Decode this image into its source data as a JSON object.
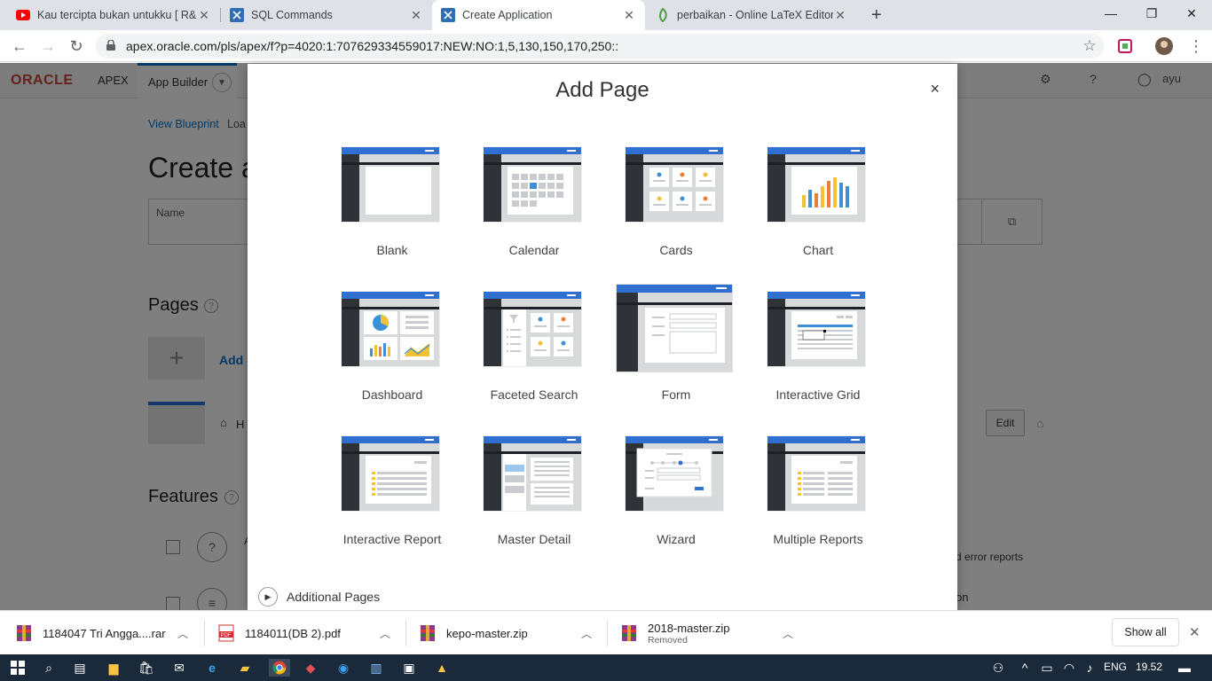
{
  "browser": {
    "tabs": [
      {
        "title": "Kau tercipta bukan untukku [ R&",
        "icon": "youtube-icon"
      },
      {
        "title": "SQL Commands",
        "icon": "apex-icon"
      },
      {
        "title": "Create Application",
        "icon": "apex-icon"
      },
      {
        "title": "perbaikan - Online LaTeX Editor O",
        "icon": "overleaf-icon"
      }
    ],
    "new_tab": "+",
    "url": "apex.oracle.com/pls/apex/f?p=4020:1:707629334559017:NEW:NO:1,5,130,150,170,250::"
  },
  "apex": {
    "logo": "ORACLE",
    "apex_label": "APEX",
    "app_builder": "App Builder",
    "user": "ayu",
    "breadcrumbs": [
      "View Blueprint",
      "Loa"
    ],
    "page_title": "Create a",
    "name_label": "Name",
    "pages_heading": "Pages",
    "add_link": "Add",
    "home_text": "H",
    "edit_button": "Edit",
    "features_heading": "Features",
    "feature_text_1": "d error reports",
    "feature_text_2": "on",
    "feature_letter": "A"
  },
  "modal": {
    "title": "Add Page",
    "close": "×",
    "page_types": [
      {
        "label": "Blank"
      },
      {
        "label": "Calendar"
      },
      {
        "label": "Cards"
      },
      {
        "label": "Chart"
      },
      {
        "label": "Dashboard"
      },
      {
        "label": "Faceted Search"
      },
      {
        "label": "Form"
      },
      {
        "label": "Interactive Grid"
      },
      {
        "label": "Interactive Report"
      },
      {
        "label": "Master Detail"
      },
      {
        "label": "Wizard"
      },
      {
        "label": "Multiple Reports"
      }
    ],
    "additional_pages": "Additional Pages"
  },
  "downloads": {
    "items": [
      {
        "name": "1184047 Tri Angga....rar",
        "status": ""
      },
      {
        "name": "1184011(DB 2).pdf",
        "status": ""
      },
      {
        "name": "kepo-master.zip",
        "status": ""
      },
      {
        "name": "2018-master.zip",
        "status": "Removed"
      }
    ],
    "show_all": "Show all"
  },
  "taskbar": {
    "language": "ENG",
    "time": "19.52"
  },
  "colors": {
    "accent_blue": "#0572ce",
    "oracle_red": "#c74634",
    "thumb_blue": "#2e6fd0",
    "thumb_dark": "#2f3338"
  }
}
